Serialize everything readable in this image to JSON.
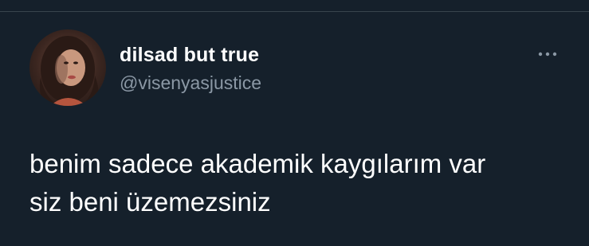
{
  "tweet": {
    "author": {
      "display_name": "dilsad but true",
      "handle": "@visenyasjustice",
      "avatar_icon": "profile-photo"
    },
    "more_icon": "ellipsis-icon",
    "text": "benim sadece akademik kaygılarım var\nsiz beni üzemezsiniz"
  },
  "colors": {
    "background": "#15202b",
    "primary_text": "#ffffff",
    "secondary_text": "#8b98a5",
    "divider": "#38444d"
  }
}
